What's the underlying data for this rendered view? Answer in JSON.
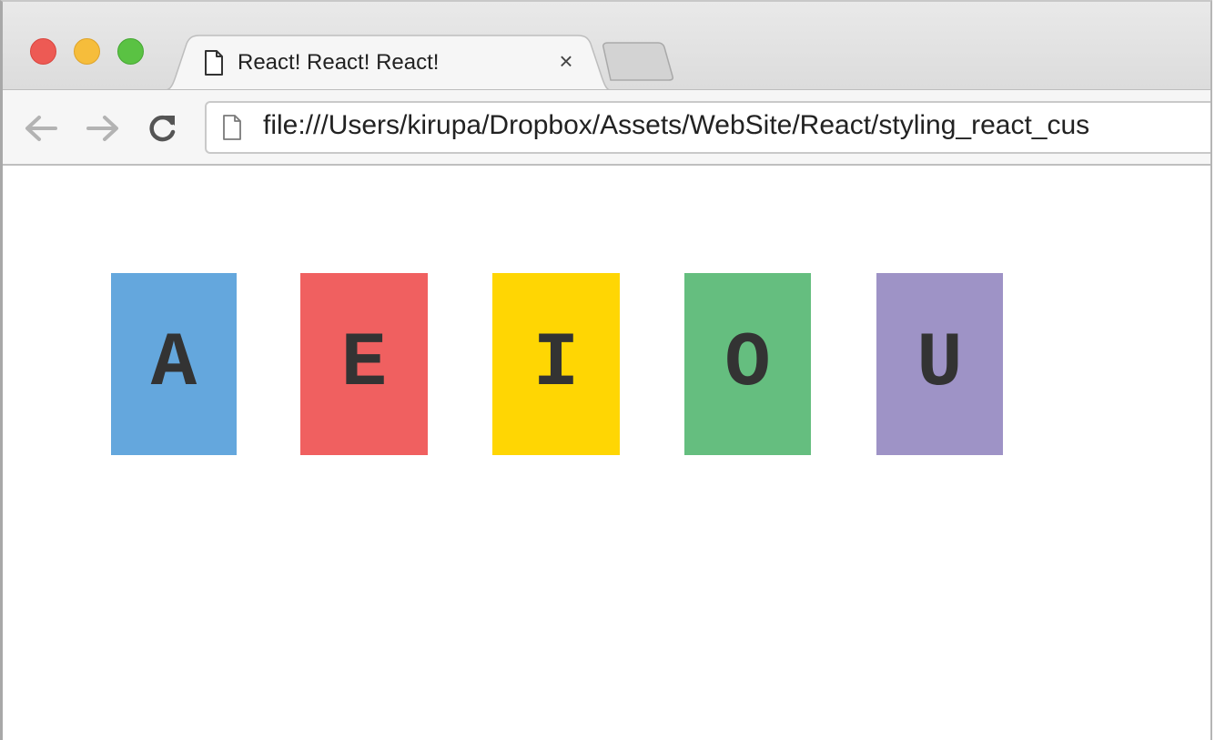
{
  "browser": {
    "tab": {
      "title": "React! React! React!",
      "close_glyph": "×"
    },
    "address_bar": {
      "url": "file:///Users/kirupa/Dropbox/Assets/WebSite/React/styling_react_cus"
    },
    "icons": {
      "back": "arrow-left-icon",
      "forward": "arrow-right-icon",
      "reload": "reload-icon",
      "page": "page-icon"
    }
  },
  "page": {
    "letters": [
      {
        "label": "A",
        "color": "#64a7dd"
      },
      {
        "label": "E",
        "color": "#f06060"
      },
      {
        "label": "I",
        "color": "#ffd603"
      },
      {
        "label": "O",
        "color": "#65be7f"
      },
      {
        "label": "U",
        "color": "#9e93c6"
      }
    ],
    "text_color": "#333333"
  }
}
